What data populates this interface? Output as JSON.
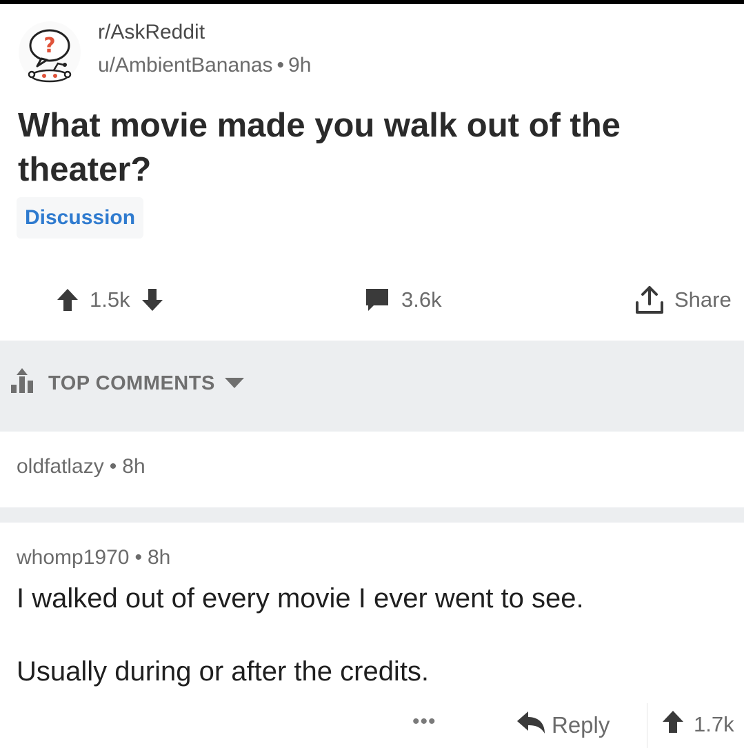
{
  "post": {
    "subreddit": "r/AskReddit",
    "author": "u/AmbientBananas",
    "separator": "•",
    "age": "9h",
    "title": "What movie made you walk out of the theater?",
    "flair": "Discussion",
    "upvotes": "1.5k",
    "comments": "3.6k",
    "share_label": "Share"
  },
  "sort": {
    "label": "TOP COMMENTS"
  },
  "comments": [
    {
      "author": "oldfatlazy",
      "separator": "•",
      "age": "8h"
    },
    {
      "author": "whomp1970",
      "separator": "•",
      "age": "8h",
      "body_line1": "I walked out of every movie I ever went to see.",
      "body_line2": "Usually during or after the credits.",
      "more_label": "•••",
      "reply_label": "Reply",
      "votes": "1.7k"
    }
  ],
  "colors": {
    "flair_text": "#2f7bcf",
    "meta_gray": "#6b6b6b",
    "sort_bg": "#eceef0",
    "askreddit_orange": "#e0533a"
  },
  "icons": [
    "askreddit-snoo-icon",
    "upvote-icon",
    "downvote-icon",
    "comment-icon",
    "share-icon",
    "sort-icon",
    "caret-down-icon",
    "reply-icon"
  ]
}
